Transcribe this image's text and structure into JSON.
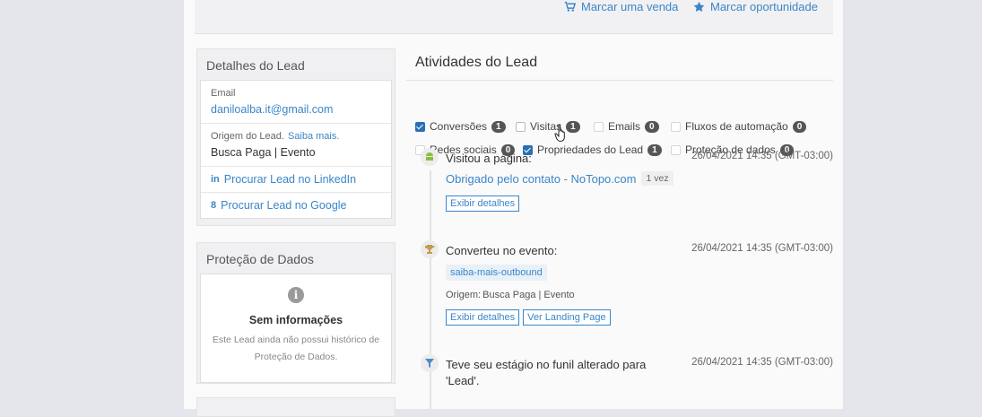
{
  "topbar": {
    "mark_sale": "Marcar uma venda",
    "mark_opportunity": "Marcar oportunidade"
  },
  "lead_details": {
    "title": "Detalhes do Lead",
    "email_label": "Email",
    "email_value": "daniloalba.it@gmail.com",
    "origin_label": "Origem do Lead.",
    "origin_more": "Saiba mais.",
    "origin_value": "Busca Paga | Evento",
    "linkedin_label": "Procurar Lead no LinkedIn",
    "linkedin_icon": "in",
    "google_label": "Procurar Lead no Google",
    "google_icon": "8"
  },
  "data_protection": {
    "title": "Proteção de Dados",
    "empty_icon": "i",
    "empty_heading": "Sem informações",
    "empty_desc_line1": "Este Lead ainda não possui histórico de",
    "empty_desc_line2": "Proteção de Dados."
  },
  "activities": {
    "title": "Atividades do Lead",
    "filters": [
      {
        "label": "Conversões",
        "count": "1",
        "checked": true
      },
      {
        "label": "Visitas",
        "count": "1",
        "checked": false
      },
      {
        "label": "Emails",
        "count": "0",
        "checked": false
      },
      {
        "label": "Fluxos de automação",
        "count": "0",
        "checked": false
      },
      {
        "label": "Redes sociais",
        "count": "0",
        "checked": false
      },
      {
        "label": "Propriedades do Lead",
        "count": "1",
        "checked": true
      },
      {
        "label": "Proteção de dados",
        "count": "0",
        "checked": false
      }
    ],
    "events": [
      {
        "title": "Visitou a página:",
        "date": "26/04/2021 14:35 (GMT-03:00)",
        "page_link": "Obrigado pelo contato - NoTopo.com",
        "visits": "1 vez",
        "details_btn": "Exibir detalhes"
      },
      {
        "title": "Converteu no evento:",
        "date": "26/04/2021 14:35 (GMT-03:00)",
        "event_tag": "saiba-mais-outbound",
        "origin_label": "Origem:",
        "origin_value": "Busca Paga | Evento",
        "details_btn": "Exibir detalhes",
        "landing_btn": "Ver Landing Page"
      },
      {
        "title": "Teve seu estágio no funil alterado para 'Lead'.",
        "date": "26/04/2021 14:35 (GMT-03:00)"
      }
    ]
  },
  "colors": {
    "accent": "#3a86c8",
    "badge": "#555555",
    "checked": "#2a6fb5"
  },
  "icons": [
    "cart-icon",
    "star-icon",
    "info-icon",
    "android-icon",
    "trophy-icon",
    "funnel-icon",
    "linkedin-icon",
    "google-icon"
  ]
}
